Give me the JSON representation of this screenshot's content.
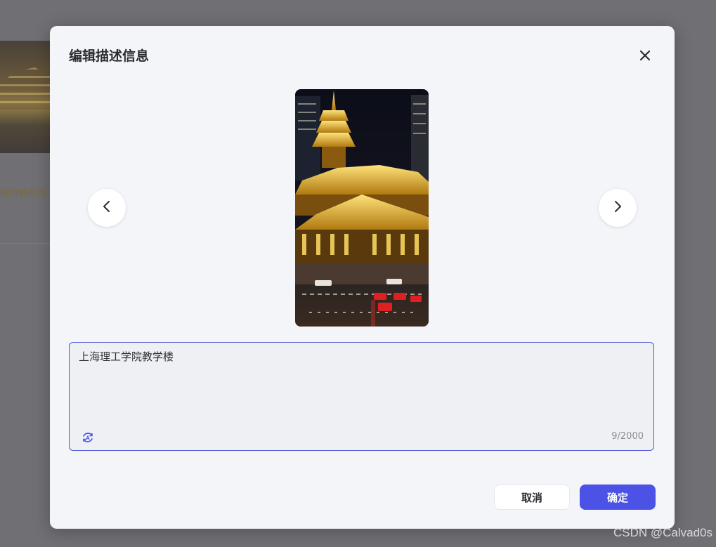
{
  "background": {
    "partial_text": "被检索召回"
  },
  "dialog": {
    "title": "编辑描述信息",
    "close_icon": "close-icon",
    "prev_icon": "chevron-left-icon",
    "next_icon": "chevron-right-icon",
    "description": {
      "value": "上海理工学院教学楼",
      "char_count": "9/2000",
      "ai_icon": "ai-rewrite-icon"
    },
    "buttons": {
      "cancel": "取消",
      "confirm": "确定"
    }
  },
  "colors": {
    "accent": "#4c52e6",
    "overlay": "#6f6f74",
    "dialog_bg": "#f4f5f9"
  },
  "watermark": "CSDN @Calvad0s"
}
